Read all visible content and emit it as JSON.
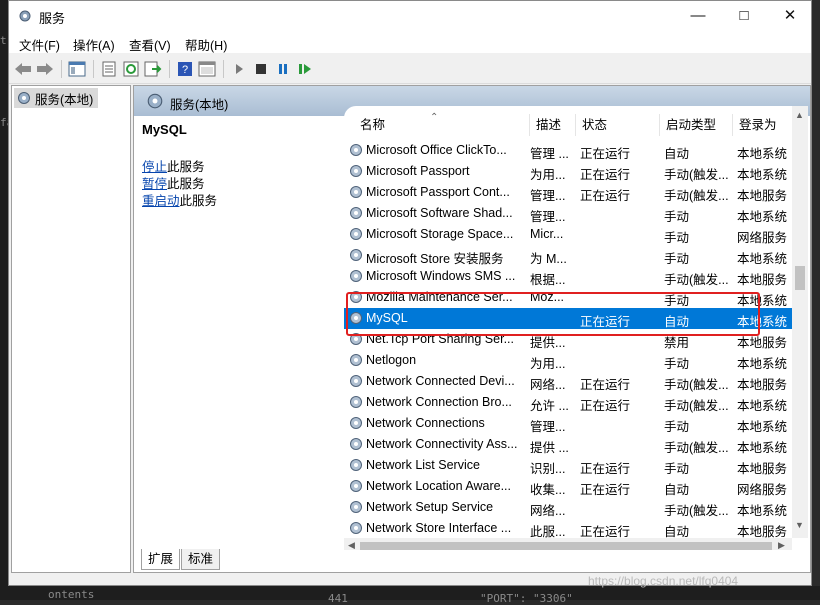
{
  "window": {
    "title": "服务",
    "min_icon": "minimize-icon",
    "max_icon": "maximize-icon",
    "close_icon": "close-icon"
  },
  "menu": [
    "文件(F)",
    "操作(A)",
    "查看(V)",
    "帮助(H)"
  ],
  "toolbar": [
    "back-arrow-icon",
    "forward-arrow-icon",
    "show-hide-tree-icon",
    "properties-icon",
    "refresh-icon",
    "export-list-icon",
    "help-icon",
    "console-icon",
    "start-service-icon",
    "stop-service-icon",
    "pause-service-icon",
    "restart-service-icon"
  ],
  "tree": {
    "root": "服务(本地)"
  },
  "pane": {
    "header": "服务(本地)"
  },
  "detail": {
    "service_name": "MySQL",
    "actions": [
      {
        "link": "停止",
        "rest": "此服务"
      },
      {
        "link": "暂停",
        "rest": "此服务"
      },
      {
        "link": "重启动",
        "rest": "此服务"
      }
    ]
  },
  "columns": [
    "名称",
    "描述",
    "状态",
    "启动类型",
    "登录为"
  ],
  "rows": [
    [
      "Microsoft Office ClickTo...",
      "管理 ...",
      "正在运行",
      "自动",
      "本地系统"
    ],
    [
      "Microsoft Passport",
      "为用...",
      "正在运行",
      "手动(触发...",
      "本地系统"
    ],
    [
      "Microsoft Passport Cont...",
      "管理...",
      "正在运行",
      "手动(触发...",
      "本地服务"
    ],
    [
      "Microsoft Software Shad...",
      "管理...",
      "",
      "手动",
      "本地系统"
    ],
    [
      "Microsoft Storage Space...",
      "Micr...",
      "",
      "手动",
      "网络服务"
    ],
    [
      "Microsoft Store 安装服务",
      "为 M...",
      "",
      "手动",
      "本地系统"
    ],
    [
      "Microsoft Windows SMS ...",
      "根据...",
      "",
      "手动(触发...",
      "本地服务"
    ],
    [
      "Mozilla Maintenance Ser...",
      "Moz...",
      "",
      "手动",
      "本地系统"
    ],
    [
      "MySQL",
      "",
      "正在运行",
      "自动",
      "本地系统"
    ],
    [
      "Net.Tcp Port Sharing Ser...",
      "提供...",
      "",
      "禁用",
      "本地服务"
    ],
    [
      "Netlogon",
      "为用...",
      "",
      "手动",
      "本地系统"
    ],
    [
      "Network Connected Devi...",
      "网络...",
      "正在运行",
      "手动(触发...",
      "本地服务"
    ],
    [
      "Network Connection Bro...",
      "允许 ...",
      "正在运行",
      "手动(触发...",
      "本地系统"
    ],
    [
      "Network Connections",
      "管理...",
      "",
      "手动",
      "本地系统"
    ],
    [
      "Network Connectivity Ass...",
      "提供 ...",
      "",
      "手动(触发...",
      "本地系统"
    ],
    [
      "Network List Service",
      "识别...",
      "正在运行",
      "手动",
      "本地服务"
    ],
    [
      "Network Location Aware...",
      "收集...",
      "正在运行",
      "自动",
      "网络服务"
    ],
    [
      "Network Setup Service",
      "网络...",
      "",
      "手动(触发...",
      "本地系统"
    ],
    [
      "Network Store Interface ...",
      "此服...",
      "正在运行",
      "自动",
      "本地服务"
    ]
  ],
  "selected_row": 8,
  "tabs": [
    "扩展",
    "标准"
  ],
  "background_text": [
    "t",
    "fa",
    "ontents",
    "441",
    "\"PORT\": \"3306\""
  ],
  "watermark": "https://blog.csdn.net/lfq0404",
  "colors": {
    "selection": "#0078d7",
    "highlight_box": "#e02020",
    "link": "#0645ad"
  }
}
